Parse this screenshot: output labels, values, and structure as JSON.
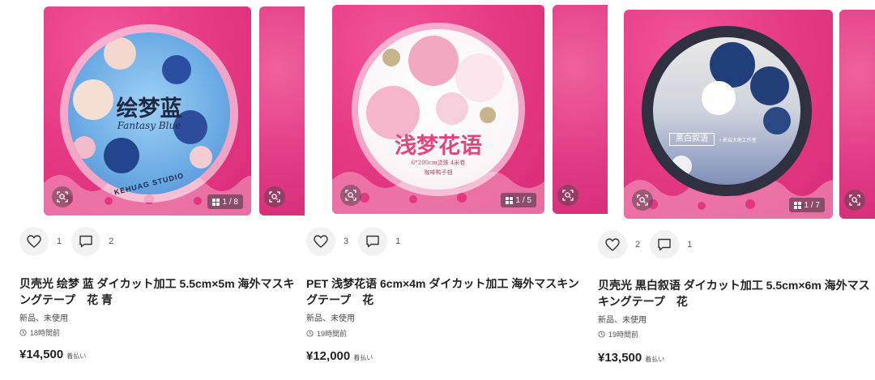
{
  "items": [
    {
      "tape_title": "绘梦蓝",
      "tape_subtitle": "Fantasy Blue",
      "tape_rim": "KEHUAG STUDIO",
      "image_counter": "1 / 8",
      "likes": "1",
      "comments": "2",
      "title": "贝壳光 绘梦 蓝 ダイカット加工 5.5cm×5m 海外マスキングテープ　花 青",
      "condition": "新品、未使用",
      "time": "18時間前",
      "price": "¥14,500",
      "shipping": "着払い"
    },
    {
      "tape_title": "浅梦花语",
      "tape_subtitle": "6*200cm烫珠  4米卷",
      "tape_subtitle2": "咖啡鸭子相",
      "image_counter": "1 / 5",
      "likes": "3",
      "comments": "1",
      "title": "PET 浅梦花语 6cm×4m ダイカット加工 海外マスキングテープ　花",
      "condition": "新品、未使用",
      "time": "19時間前",
      "price": "¥12,000",
      "shipping": "着払い"
    },
    {
      "tape_label": "黑白叙语",
      "tape_label_small": "• 来自大地工作室",
      "image_counter": "1 / 7",
      "likes": "2",
      "comments": "1",
      "title": "贝壳光 黒白叙语 ダイカット加工 5.5cm×6m 海外マスキングテープ　花",
      "condition": "新品、未使用",
      "time": "19時間前",
      "price": "¥13,500",
      "shipping": "着払い"
    }
  ],
  "icons": {
    "lens": "image-search-icon",
    "grid": "gallery-grid-icon",
    "like": "heart-icon",
    "comment": "comment-icon",
    "clock": "clock-icon"
  },
  "colors": {
    "photo_bg": "#e63a84",
    "stat_bg": "#f2f2f2",
    "text": "#222222"
  }
}
